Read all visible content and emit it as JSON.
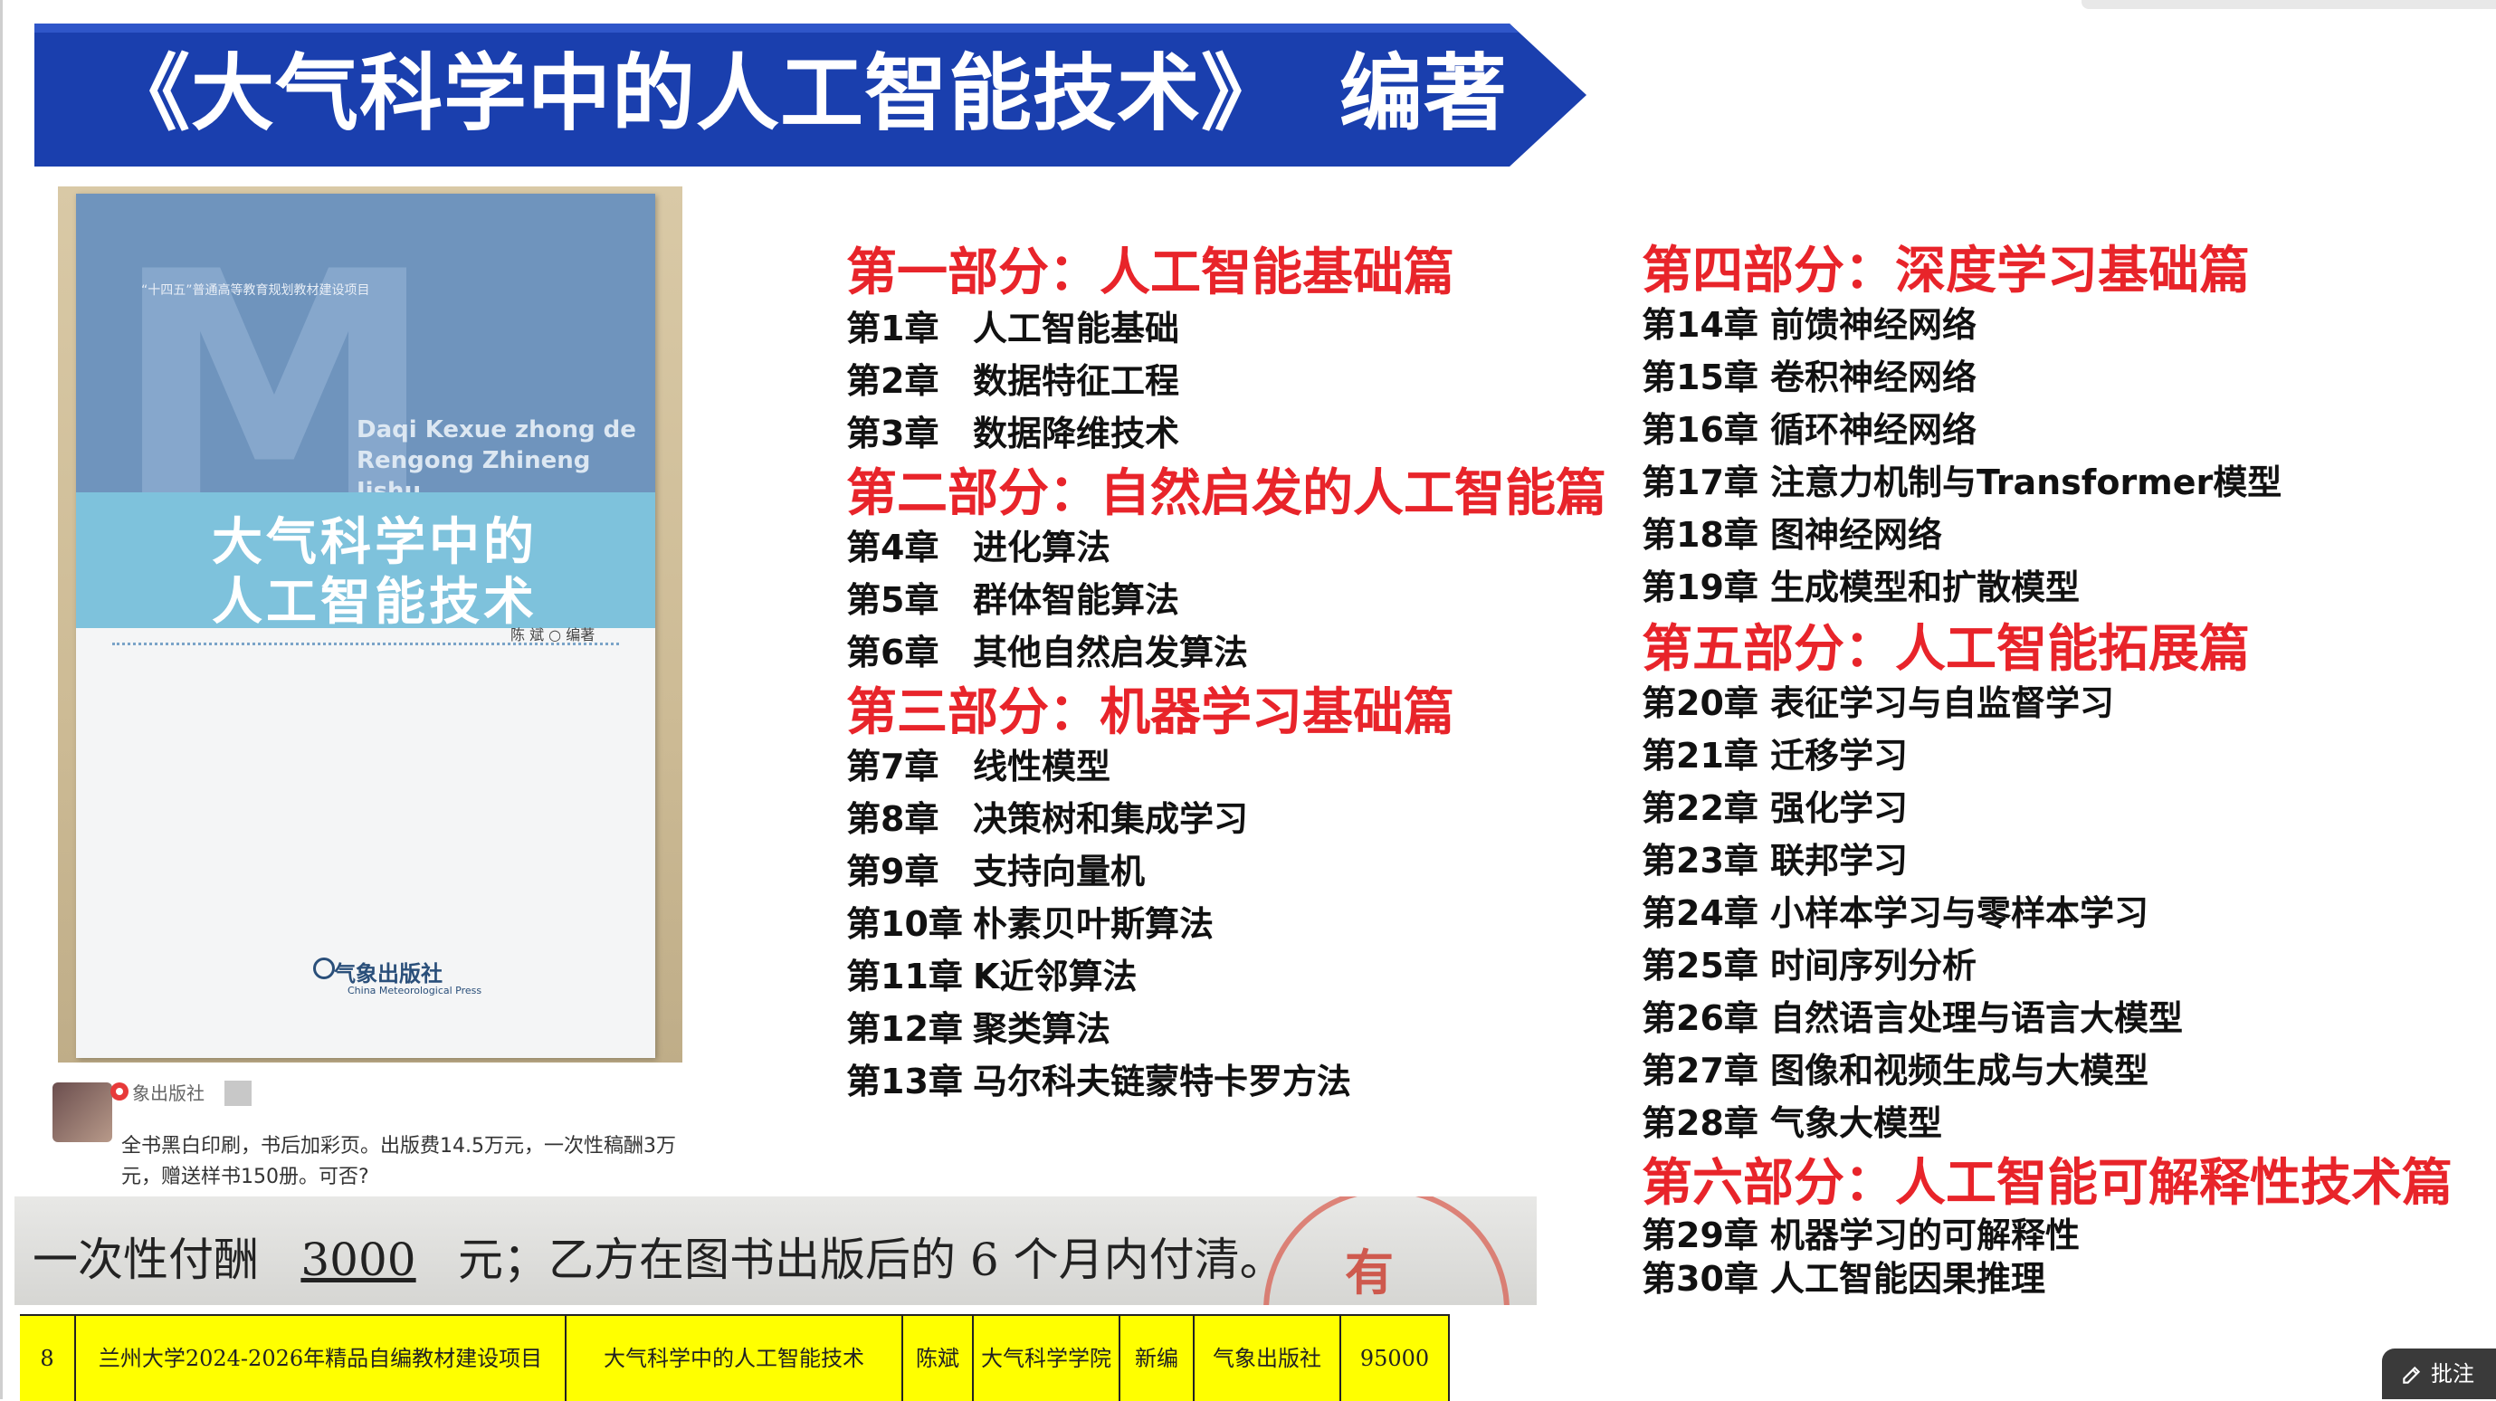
{
  "banner": {
    "title": "《大气科学中的人工智能技术》",
    "author_role": "编著",
    "bg_color": "#1a3fae"
  },
  "book_cover": {
    "series": "“十四五”普通高等教育规划教材建设项目",
    "pinyin_line1": "Daqi Kexue zhong de",
    "pinyin_line2": "Rengong Zhineng Jishu",
    "title_line1": "大气科学中的",
    "title_line2": "人工智能技术",
    "author": "陈  斌  ○ 编著",
    "publisher": "气象出版社",
    "publisher_en": "China Meteorological Press"
  },
  "chat": {
    "sender": "象出版社",
    "message": "全书黑白印刷，书后加彩页。出版费14.5万元，一次性稿酬3万元，赠送样书150册。可否?"
  },
  "contract": {
    "prefix": "一次性付酬",
    "amount": "3000",
    "suffix": "元；乙方在图书出版后的 6 个月内付清。",
    "stamp_text": "有"
  },
  "table_row": {
    "index": "8",
    "project": "兰州大学2024-2026年精品自编教材建设项目",
    "book": "大气科学中的人工智能技术",
    "author": "陈斌",
    "college": "大气科学学院",
    "type": "新编",
    "publisher": "气象出版社",
    "amount": "95000"
  },
  "toc": {
    "parts": [
      {
        "title": "第一部分：人工智能基础篇",
        "chapters": [
          {
            "num": "第1章",
            "title": "人工智能基础"
          },
          {
            "num": "第2章",
            "title": "数据特征工程"
          },
          {
            "num": "第3章",
            "title": "数据降维技术"
          }
        ]
      },
      {
        "title": "第二部分：自然启发的人工智能篇",
        "chapters": [
          {
            "num": "第4章",
            "title": "进化算法"
          },
          {
            "num": "第5章",
            "title": "群体智能算法"
          },
          {
            "num": "第6章",
            "title": "其他自然启发算法"
          }
        ]
      },
      {
        "title": "第三部分：机器学习基础篇",
        "chapters": [
          {
            "num": "第7章",
            "title": "线性模型"
          },
          {
            "num": "第8章",
            "title": "决策树和集成学习"
          },
          {
            "num": "第9章",
            "title": "支持向量机"
          },
          {
            "num": "第10章",
            "title": "朴素贝叶斯算法"
          },
          {
            "num": "第11章",
            "title": "K近邻算法"
          },
          {
            "num": "第12章",
            "title": "聚类算法"
          },
          {
            "num": "第13章",
            "title": "马尔科夫链蒙特卡罗方法"
          }
        ]
      },
      {
        "title": "第四部分：深度学习基础篇",
        "chapters": [
          {
            "num": "第14章",
            "title": "前馈神经网络"
          },
          {
            "num": "第15章",
            "title": "卷积神经网络"
          },
          {
            "num": "第16章",
            "title": "循环神经网络"
          },
          {
            "num": "第17章",
            "title": "注意力机制与Transformer模型"
          },
          {
            "num": "第18章",
            "title": "图神经网络"
          },
          {
            "num": "第19章",
            "title": "生成模型和扩散模型"
          }
        ]
      },
      {
        "title": "第五部分：人工智能拓展篇",
        "chapters": [
          {
            "num": "第20章",
            "title": "表征学习与自监督学习"
          },
          {
            "num": "第21章",
            "title": "迁移学习"
          },
          {
            "num": "第22章",
            "title": "强化学习"
          },
          {
            "num": "第23章",
            "title": "联邦学习"
          },
          {
            "num": "第24章",
            "title": "小样本学习与零样本学习"
          },
          {
            "num": "第25章",
            "title": "时间序列分析"
          },
          {
            "num": "第26章",
            "title": "自然语言处理与语言大模型"
          },
          {
            "num": "第27章",
            "title": "图像和视频生成与大模型"
          },
          {
            "num": "第28章",
            "title": "气象大模型"
          }
        ]
      },
      {
        "title": "第六部分：人工智能可解释性技术篇",
        "chapters": [
          {
            "num": "第29章",
            "title": "机器学习的可解释性"
          },
          {
            "num": "第30章",
            "title": "人工智能因果推理"
          }
        ]
      }
    ]
  },
  "comment_button": {
    "label": "批注",
    "icon": "pen-icon"
  },
  "colors": {
    "section_red": "#e8242a",
    "banner_blue": "#1a3fae",
    "highlight_yellow": "#ffff00"
  }
}
